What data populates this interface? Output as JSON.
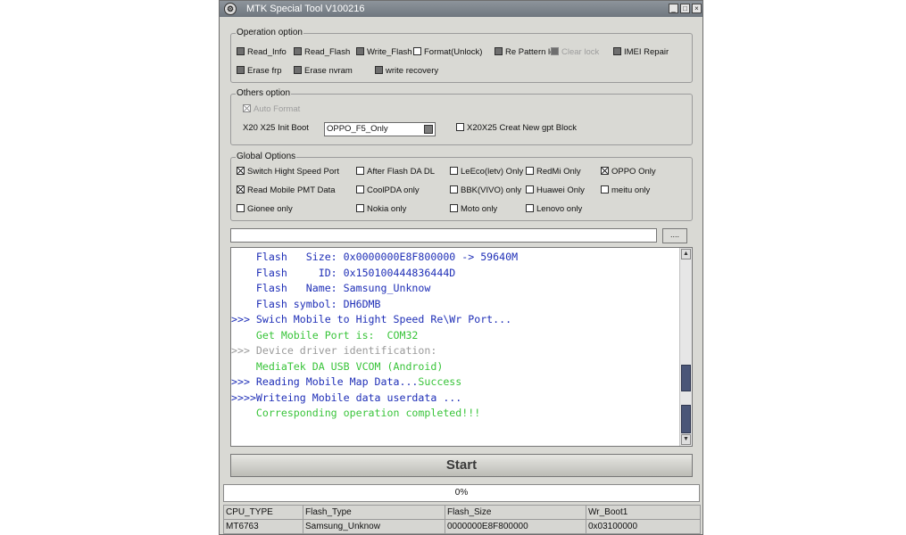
{
  "window": {
    "title": "MTK Special Tool V100216",
    "controls": [
      "_",
      "□",
      "×"
    ]
  },
  "operation_option": {
    "legend": "Operation option",
    "items": [
      {
        "label": "Read_Info",
        "state": "unchecked"
      },
      {
        "label": "Read_Flash",
        "state": "unchecked"
      },
      {
        "label": "Write_Flash",
        "state": "unchecked"
      },
      {
        "label": "Format(Unlock)",
        "state": "open"
      },
      {
        "label": "Re Pattern lo",
        "state": "unchecked"
      },
      {
        "label": "Clear lock",
        "state": "disabled"
      },
      {
        "label": "IMEI Repair",
        "state": "unchecked"
      },
      {
        "label": "Erase frp",
        "state": "unchecked"
      },
      {
        "label": "Erase nvram",
        "state": "unchecked"
      },
      {
        "label": "write recovery",
        "state": "unchecked"
      }
    ]
  },
  "others_option": {
    "legend": "Others option",
    "auto_format": "Auto Format",
    "init_boot_label": "X20 X25 Init Boot",
    "init_boot_value": "OPPO_F5_Only",
    "gpt_block": "X20X25 Creat New gpt Block"
  },
  "global_options": {
    "legend": "Global Options",
    "items": [
      {
        "label": "Switch Hight Speed Port",
        "state": "checked"
      },
      {
        "label": "After Flash DA DL",
        "state": "open"
      },
      {
        "label": "LeEco(letv) Only",
        "state": "open"
      },
      {
        "label": "RedMi Only",
        "state": "open"
      },
      {
        "label": "OPPO Only",
        "state": "checked"
      },
      {
        "label": "Read Mobile PMT Data",
        "state": "checked"
      },
      {
        "label": "CoolPDA only",
        "state": "open"
      },
      {
        "label": "BBK(VIVO) only",
        "state": "open"
      },
      {
        "label": "Huawei Only",
        "state": "open"
      },
      {
        "label": "meitu only",
        "state": "open"
      },
      {
        "label": "Gionee only",
        "state": "open"
      },
      {
        "label": "Nokia only",
        "state": "open"
      },
      {
        "label": "Moto only",
        "state": "open"
      },
      {
        "label": "Lenovo only",
        "state": "open"
      }
    ]
  },
  "file_path": {
    "value": "",
    "browse_label": "...."
  },
  "log": {
    "lines": [
      {
        "text": "    Flash   Size: 0x0000000E8F800000 -> 59640M",
        "color": "blue"
      },
      {
        "text": "    Flash     ID: 0x150100444836444D",
        "color": "blue"
      },
      {
        "text": "    Flash   Name: Samsung_Unknow",
        "color": "blue"
      },
      {
        "text": "    Flash symbol: DH6DMB",
        "color": "blue"
      },
      {
        "text": ">>> Swich Mobile to Hight Speed Re\\Wr Port...",
        "color": "blue"
      },
      {
        "text": "    Get Mobile Port is:  COM32",
        "color": "green"
      },
      {
        "text": ">>> Device driver identification:",
        "color": "gray"
      },
      {
        "text": "    MediaTek DA USB VCOM (Android)",
        "color": "green"
      },
      {
        "text": ">>> Reading Mobile Map Data...",
        "color": "blue",
        "suffix": "Success",
        "suffix_color": "green"
      },
      {
        "text": ">>>>Writeing Mobile data userdata ...",
        "color": "blue"
      },
      {
        "text": "    Corresponding operation completed!!!",
        "color": "green"
      }
    ]
  },
  "start_label": "Start",
  "progress": {
    "percent": 0,
    "text": "0%"
  },
  "info_table": {
    "headers": [
      "CPU_TYPE",
      "Flash_Type",
      "Flash_Size",
      "Wr_Boot1"
    ],
    "values": [
      "MT6763",
      "Samsung_Unknow",
      "0000000E8F800000",
      "0x03100000"
    ]
  },
  "colors": {
    "log_blue": "#1f2fb7",
    "log_green": "#39c43a",
    "log_gray": "#9a9a9a",
    "window_bg": "#d9d9d4",
    "titlebar": "#7d858c"
  }
}
